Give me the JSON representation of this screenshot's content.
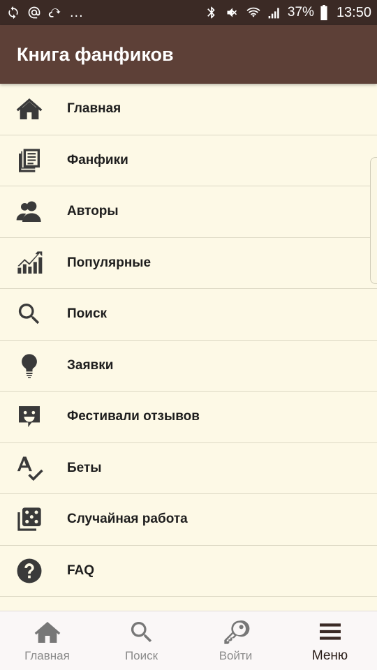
{
  "status_bar": {
    "dots": "...",
    "battery_percent": "37%",
    "time": "13:50"
  },
  "app_bar": {
    "title": "Книга фанфиков"
  },
  "menu": {
    "items": [
      {
        "label": "Главная",
        "icon": "home-icon"
      },
      {
        "label": "Фанфики",
        "icon": "documents-icon"
      },
      {
        "label": "Авторы",
        "icon": "users-icon"
      },
      {
        "label": "Популярные",
        "icon": "trending-chart-icon"
      },
      {
        "label": "Поиск",
        "icon": "search-icon"
      },
      {
        "label": "Заявки",
        "icon": "lightbulb-icon"
      },
      {
        "label": "Фестивали отзывов",
        "icon": "comment-smile-icon"
      },
      {
        "label": "Беты",
        "icon": "spellcheck-icon"
      },
      {
        "label": "Случайная работа",
        "icon": "dice-icon"
      },
      {
        "label": "FAQ",
        "icon": "help-circle-icon"
      }
    ]
  },
  "bottom_nav": {
    "items": [
      {
        "label": "Главная",
        "icon": "home-icon"
      },
      {
        "label": "Поиск",
        "icon": "search-icon"
      },
      {
        "label": "Войти",
        "icon": "key-icon"
      },
      {
        "label": "Меню",
        "icon": "menu-icon",
        "active": true
      }
    ]
  },
  "colors": {
    "status_bar": "#3b2a25",
    "app_bar": "#5d4037",
    "background": "#fdf9e6",
    "divider": "#dcd8c4"
  }
}
